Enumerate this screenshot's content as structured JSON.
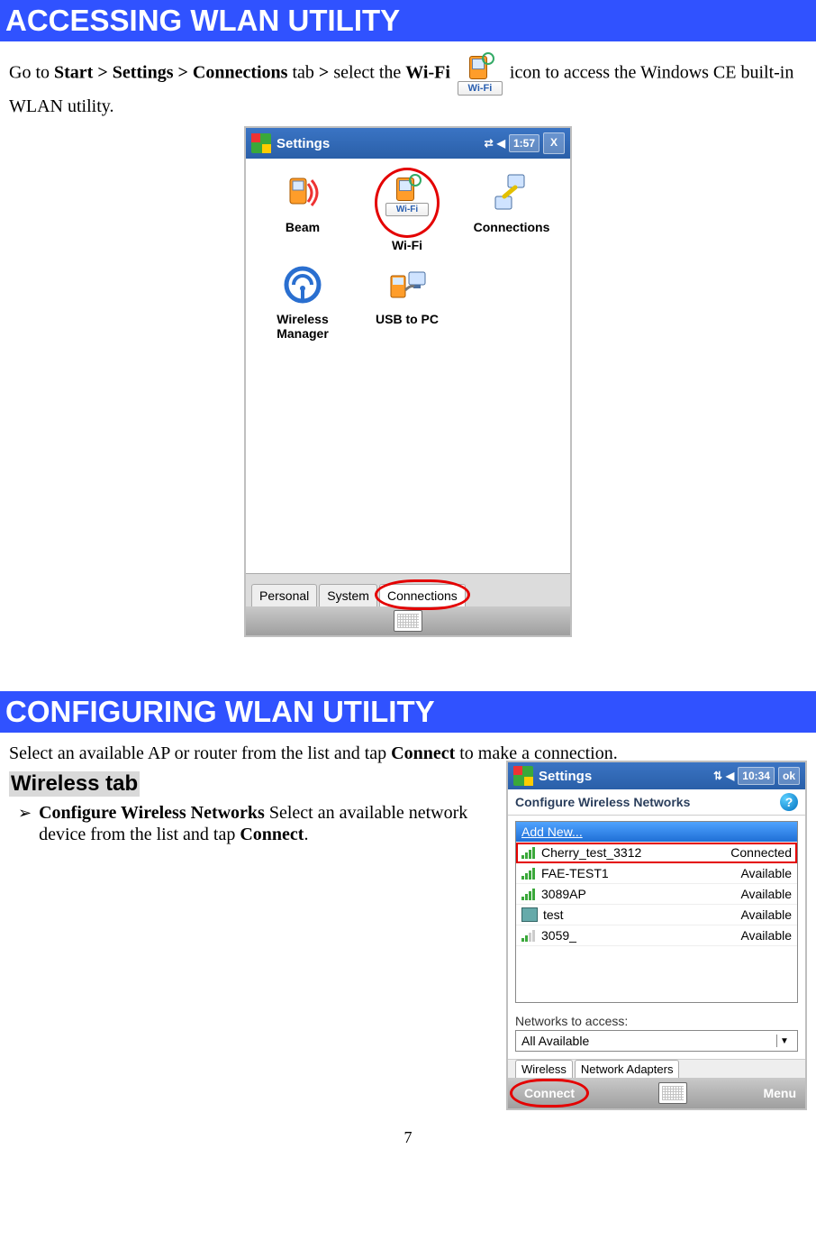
{
  "heading1": "ACCESSING WLAN UTILITY",
  "intro": {
    "pre": "Go to ",
    "bold_path": "Start > Settings > Connections",
    "mid1": " tab ",
    "bold_gt": ">",
    "mid2": " select the ",
    "bold_wifi": "Wi-Fi",
    "wifi_box_label": "Wi-Fi",
    "post": " icon to access the Windows CE built-in WLAN utility."
  },
  "shot1": {
    "title": "Settings",
    "time": "1:57",
    "close": "X",
    "icons": {
      "beam": "Beam",
      "wifi": "Wi-Fi",
      "connections": "Connections",
      "wireless_mgr_line1": "Wireless",
      "wireless_mgr_line2": "Manager",
      "usb_to_pc": "USB to PC"
    },
    "tabs": {
      "personal": "Personal",
      "system": "System",
      "connections": "Connections"
    }
  },
  "heading2": "CONFIGURING WLAN UTILITY",
  "config_intro_pre": "Select an available AP or router from the list and tap ",
  "config_intro_bold": "Connect",
  "config_intro_post": " to make a connection.",
  "subhead": "Wireless tab",
  "bullet": {
    "bold1": "Configure Wireless Networks",
    "text1": " Select an available network device from the list and tap ",
    "bold2": "Connect",
    "tail": "."
  },
  "shot2": {
    "title": "Settings",
    "time": "10:34",
    "ok": "ok",
    "subtitle": "Configure Wireless Networks",
    "add_new": "Add New...",
    "rows": [
      {
        "name": "Cherry_test_3312",
        "status": "Connected",
        "highlight": true
      },
      {
        "name": "FAE-TEST1",
        "status": "Available"
      },
      {
        "name": "3089AP",
        "status": "Available"
      },
      {
        "name": "test",
        "status": "Available",
        "pc": true
      },
      {
        "name": "3059_",
        "status": "Available",
        "weak": true
      }
    ],
    "networks_label": "Networks to access:",
    "dropdown_value": "All Available",
    "tab1": "Wireless",
    "tab2": "Network Adapters",
    "connect": "Connect",
    "menu": "Menu"
  },
  "page_number": "7"
}
